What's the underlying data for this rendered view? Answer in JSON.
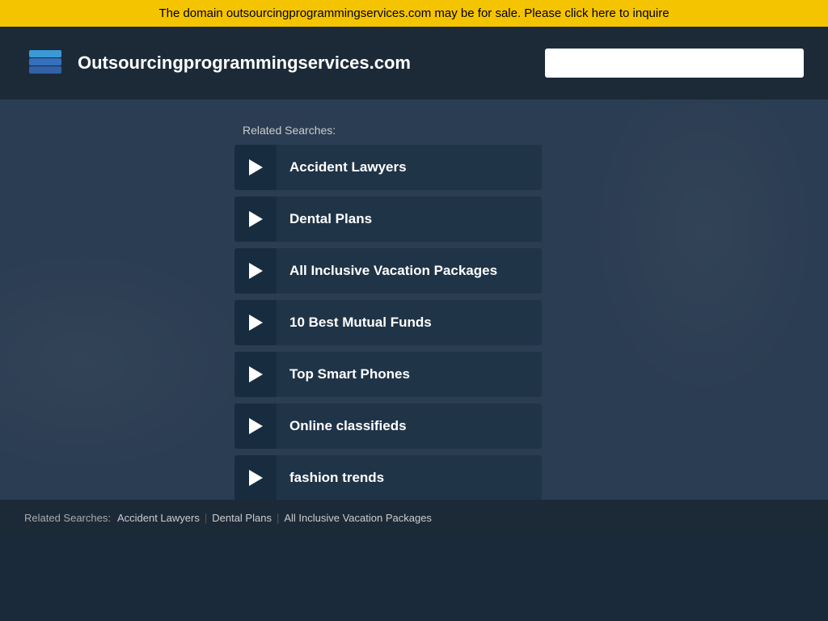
{
  "banner": {
    "text": "The domain outsourcingprogrammingservices.com may be for sale. Please click here to inquire"
  },
  "header": {
    "site_title": "Outsourcingprogrammingservices.com",
    "search_placeholder": ""
  },
  "main": {
    "related_label": "Related Searches:",
    "items": [
      {
        "label": "Accident Lawyers"
      },
      {
        "label": "Dental Plans"
      },
      {
        "label": "All Inclusive Vacation Packages"
      },
      {
        "label": "10 Best Mutual Funds"
      },
      {
        "label": "Top Smart Phones"
      },
      {
        "label": "Online classifieds"
      },
      {
        "label": "fashion trends"
      }
    ]
  },
  "footer": {
    "label": "Related Searches:",
    "links": [
      "Accident Lawyers",
      "Dental Plans",
      "All Inclusive Vacation Packages"
    ]
  }
}
